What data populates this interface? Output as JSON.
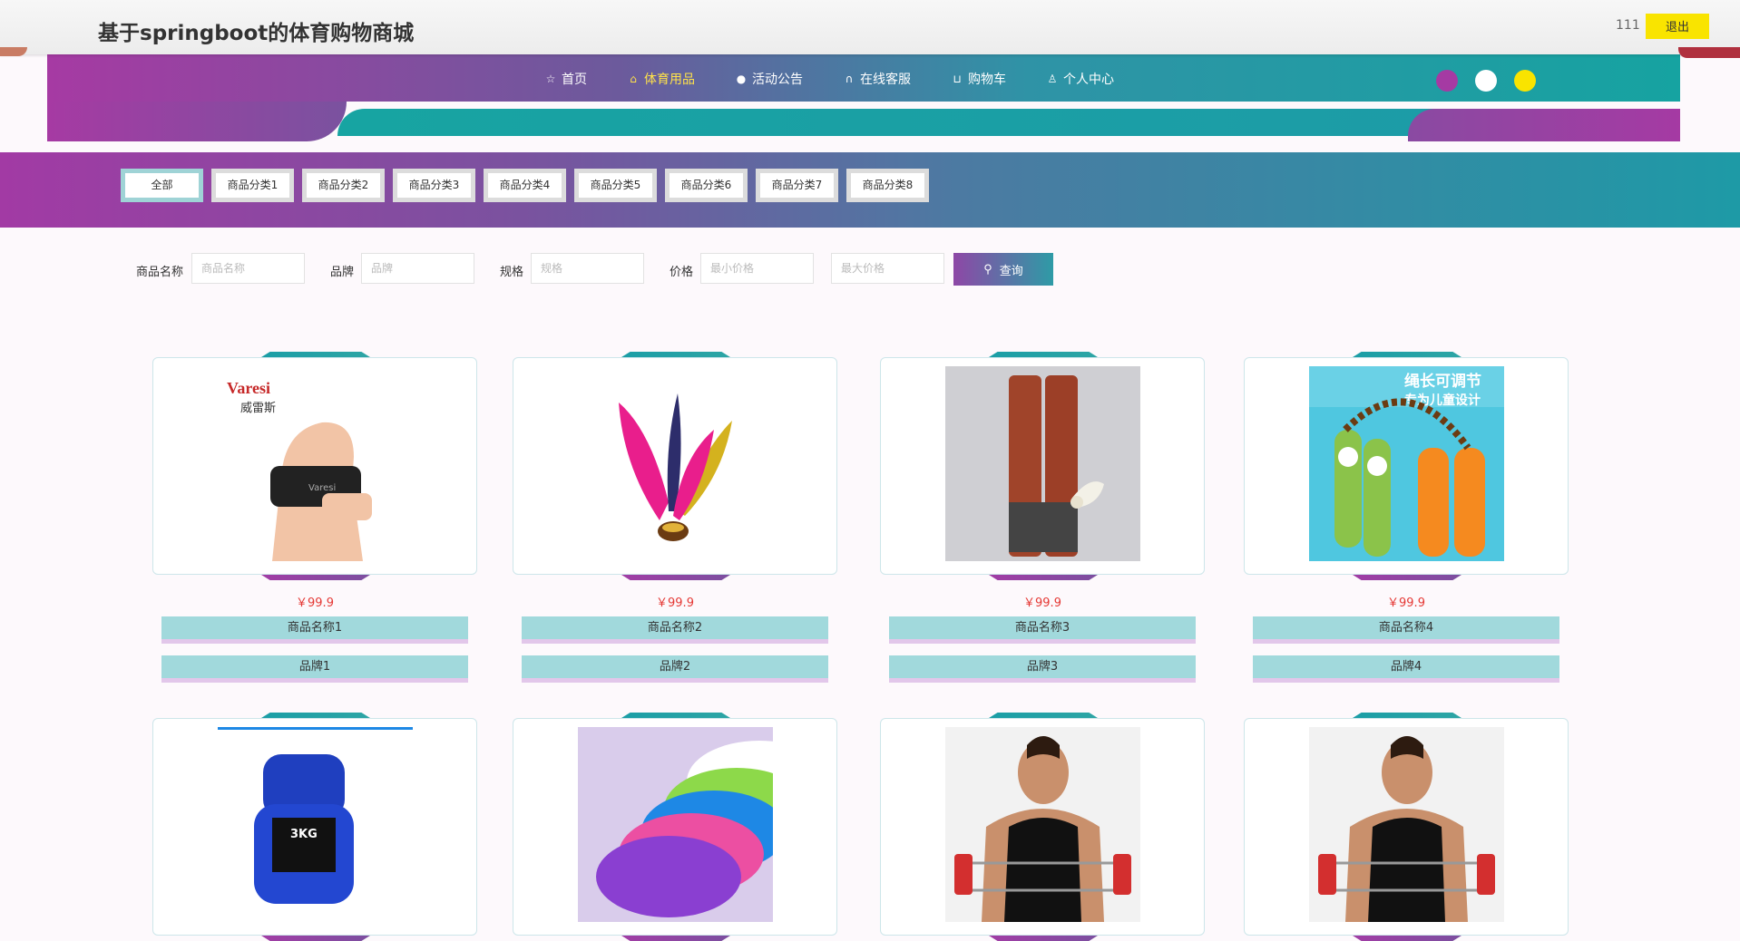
{
  "app": {
    "title": "基于springboot的体育购物商城",
    "user": "111",
    "logout": "退出"
  },
  "nav": {
    "items": [
      {
        "label": "首页",
        "icon": "star-icon",
        "glyph": "☆"
      },
      {
        "label": "体育用品",
        "icon": "bag-icon",
        "glyph": "⌂"
      },
      {
        "label": "活动公告",
        "icon": "info-icon",
        "glyph": "●"
      },
      {
        "label": "在线客服",
        "icon": "headset-icon",
        "glyph": "∩"
      },
      {
        "label": "购物车",
        "icon": "cart-icon",
        "glyph": "⊔"
      },
      {
        "label": "个人中心",
        "icon": "user-icon",
        "glyph": "♙"
      }
    ],
    "active_index": 1,
    "theme_dots": [
      "#a53aa3",
      "#ffffff",
      "#f9e400"
    ]
  },
  "categories": {
    "items": [
      "全部",
      "商品分类1",
      "商品分类2",
      "商品分类3",
      "商品分类4",
      "商品分类5",
      "商品分类6",
      "商品分类7",
      "商品分类8"
    ],
    "active_index": 0
  },
  "search": {
    "name_label": "商品名称",
    "name_placeholder": "商品名称",
    "brand_label": "品牌",
    "brand_placeholder": "品牌",
    "spec_label": "规格",
    "spec_placeholder": "规格",
    "price_label": "价格",
    "min_price_placeholder": "最小价格",
    "max_price_placeholder": "最大价格",
    "button": "查询",
    "button_icon": "search-icon"
  },
  "products": [
    {
      "price": "￥99.9",
      "name": "商品名称1",
      "brand": "品牌1",
      "image": "wrist-wrap"
    },
    {
      "price": "￥99.9",
      "name": "商品名称2",
      "brand": "品牌2",
      "image": "shuttlecock-kick"
    },
    {
      "price": "￥99.9",
      "name": "商品名称3",
      "brand": "品牌3",
      "image": "badminton-tubes"
    },
    {
      "price": "￥99.9",
      "name": "商品名称4",
      "brand": "品牌4",
      "image": "jump-rope"
    },
    {
      "image": "ankle-weights",
      "image_text": "3KG"
    },
    {
      "image": "balance-boards"
    },
    {
      "image": "chest-expander"
    },
    {
      "image": "chest-expander"
    }
  ],
  "image_text": {
    "brand_logo": "Varesi",
    "brand_logo_cn": "威雷斯",
    "promo_line1": "绳长可调节",
    "promo_line2": "专为儿童设计"
  }
}
